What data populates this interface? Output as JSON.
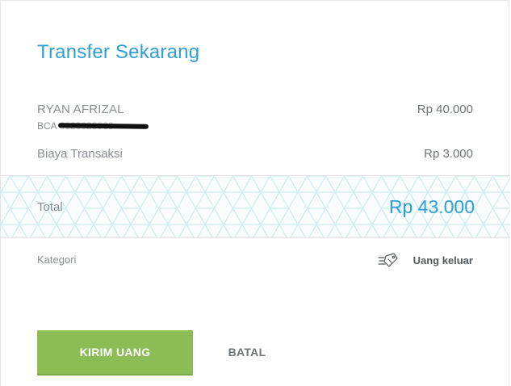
{
  "header": {
    "title": "Transfer Sekarang"
  },
  "recipient": {
    "name": "RYAN AFRIZAL",
    "bank": "BCA",
    "account_number": "0123023068",
    "amount": "Rp 40.000"
  },
  "fee": {
    "label": "Biaya Transaksi",
    "value": "Rp 3.000"
  },
  "total": {
    "label": "Total",
    "value": "Rp 43.000"
  },
  "category": {
    "label": "Kategori",
    "value": "Uang keluar",
    "icon": "tag-icon"
  },
  "actions": {
    "send_label": "KIRIM UANG",
    "cancel_label": "BATAL"
  },
  "colors": {
    "accent": "#2c9fd9",
    "send_button": "#8bbd54",
    "pattern": "#cdeaf0"
  }
}
